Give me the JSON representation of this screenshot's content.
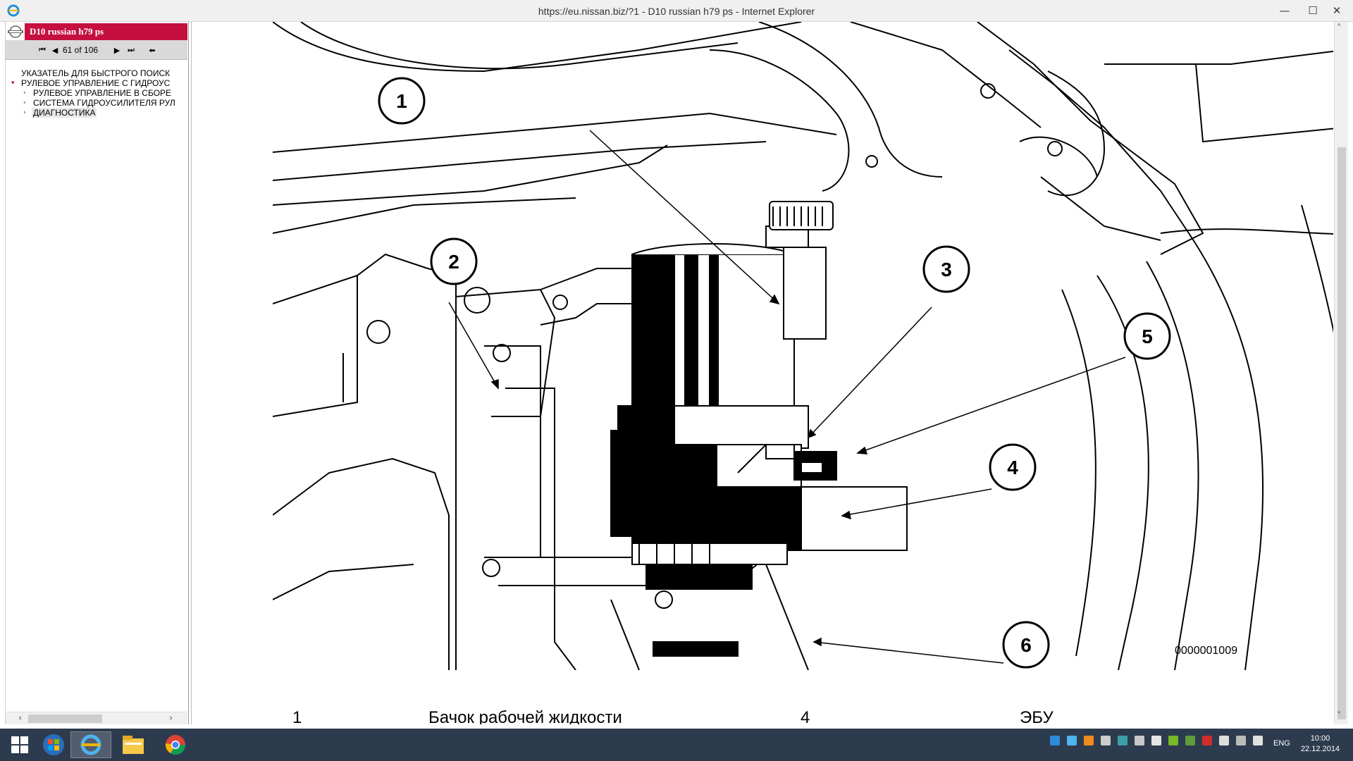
{
  "window": {
    "title": "https://eu.nissan.biz/?1 - D10 russian h79 ps - Internet Explorer",
    "minimize": "—",
    "maximize": "☐",
    "close": "✕"
  },
  "left_pane": {
    "doc_title": "D10 russian h79 ps",
    "page_counter": "61 of 106",
    "tree": [
      {
        "label": "УКАЗАТЕЛЬ ДЛЯ БЫСТРОГО ПОИСК",
        "level": 0,
        "caret": ""
      },
      {
        "label": "РУЛЕВОЕ УПРАВЛЕНИЕ С ГИДРОУС",
        "level": 0,
        "caret": "▾"
      },
      {
        "label": "РУЛЕВОЕ УПРАВЛЕНИЕ В СБОРЕ",
        "level": 1,
        "caret": "›"
      },
      {
        "label": "СИСТЕМА ГИДРОУСИЛИТЕЛЯ РУЛ",
        "level": 1,
        "caret": "›"
      },
      {
        "label": "ДИАГНОСТИКА",
        "level": 1,
        "caret": "›",
        "selected": true
      }
    ]
  },
  "diagram": {
    "callouts": [
      "1",
      "2",
      "3",
      "4",
      "5",
      "6"
    ],
    "drawing_id": "0000001009"
  },
  "bottom_row": {
    "num1": "1",
    "text1": "Бачок рабочей жидкости",
    "num2": "4",
    "text2": "ЭБУ"
  },
  "taskbar": {
    "lang": "ENG",
    "time": "10:00",
    "date": "22.12.2014"
  },
  "colors": {
    "header": "#c5103f",
    "taskbar": "#2d3b4e"
  }
}
